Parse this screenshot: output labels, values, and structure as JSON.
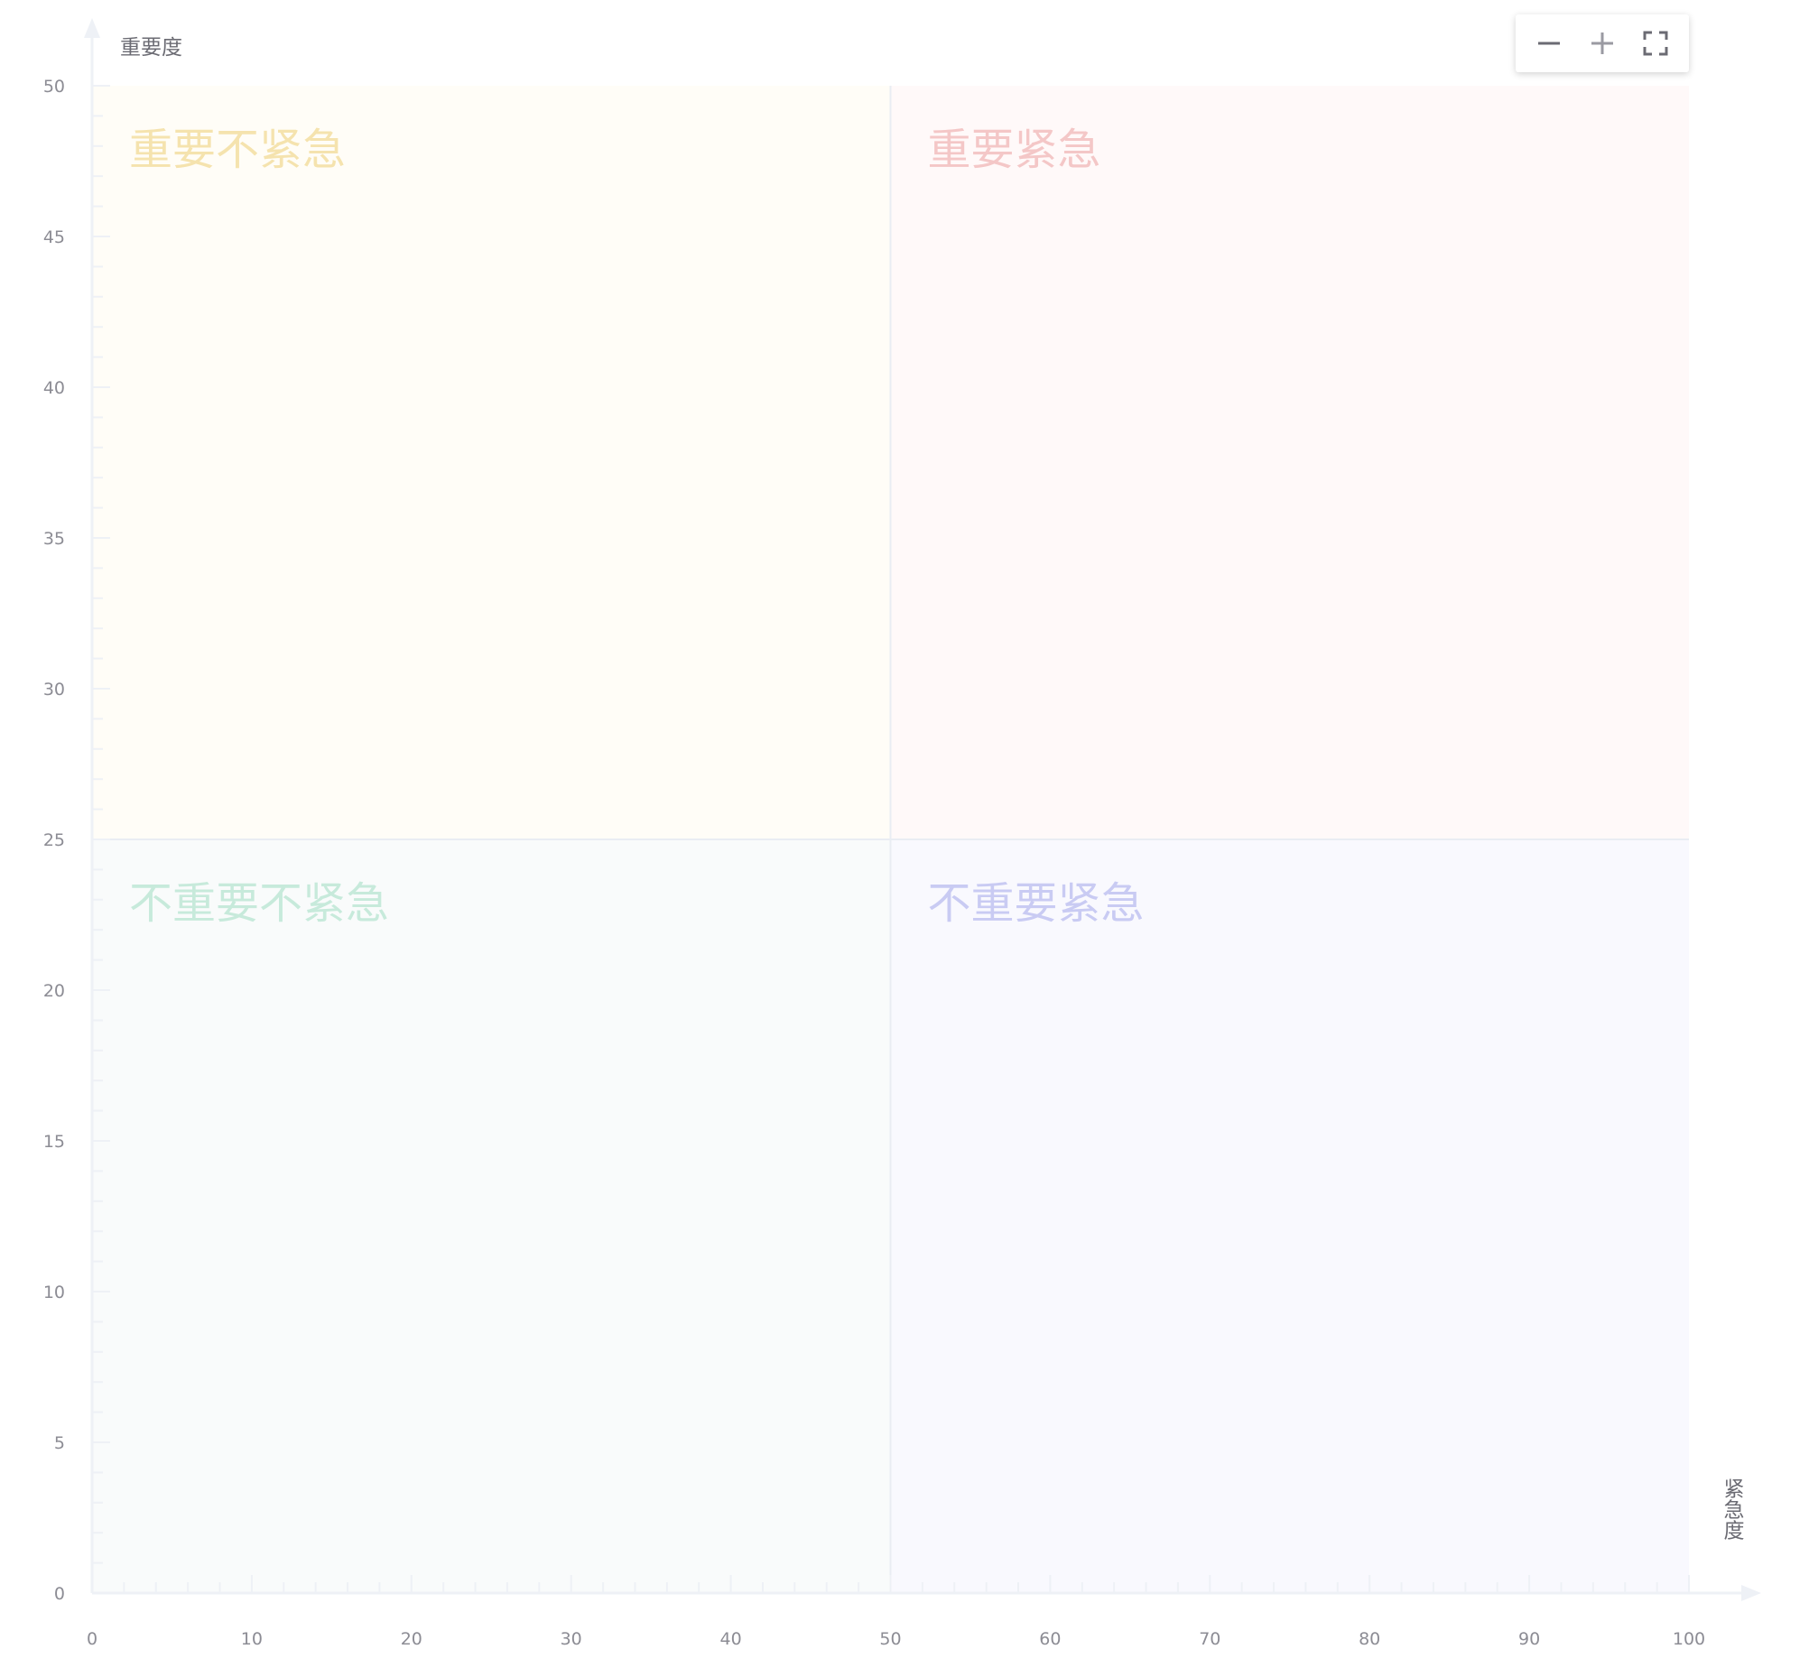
{
  "chart_data": {
    "type": "scatter",
    "title": "",
    "xlabel": "紧急度",
    "ylabel": "重要度",
    "xlim": [
      0,
      100
    ],
    "ylim": [
      0,
      50
    ],
    "x_ticks": [
      0,
      10,
      20,
      30,
      40,
      50,
      60,
      70,
      80,
      90,
      100
    ],
    "y_ticks": [
      0,
      5,
      10,
      15,
      20,
      25,
      30,
      35,
      40,
      45,
      50
    ],
    "x_minor_step": 2,
    "y_minor_step": 1,
    "grid": false,
    "points": [],
    "quadrants": [
      {
        "label": "重要不紧急",
        "x_range": [
          0,
          50
        ],
        "y_range": [
          25,
          50
        ],
        "fill": "#fffdf7",
        "text_color": "#f5e3ae"
      },
      {
        "label": "重要紧急",
        "x_range": [
          50,
          100
        ],
        "y_range": [
          25,
          50
        ],
        "fill": "#fff9f9",
        "text_color": "#f4c7c7"
      },
      {
        "label": "不重要不紧急",
        "x_range": [
          0,
          50
        ],
        "y_range": [
          0,
          25
        ],
        "fill": "#f9fbfb",
        "text_color": "#c7eadb"
      },
      {
        "label": "不重要紧急",
        "x_range": [
          50,
          100
        ],
        "y_range": [
          0,
          25
        ],
        "fill": "#f9f9fe",
        "text_color": "#c9cbf3"
      }
    ],
    "divider_color": "#e9edf3",
    "axis_color": "#eef1f6",
    "tick_label_color": "#8c8c94"
  },
  "toolbar": {
    "zoom_out_icon": "minus-icon",
    "zoom_in_icon": "plus-icon",
    "fullscreen_icon": "fullscreen-icon"
  }
}
